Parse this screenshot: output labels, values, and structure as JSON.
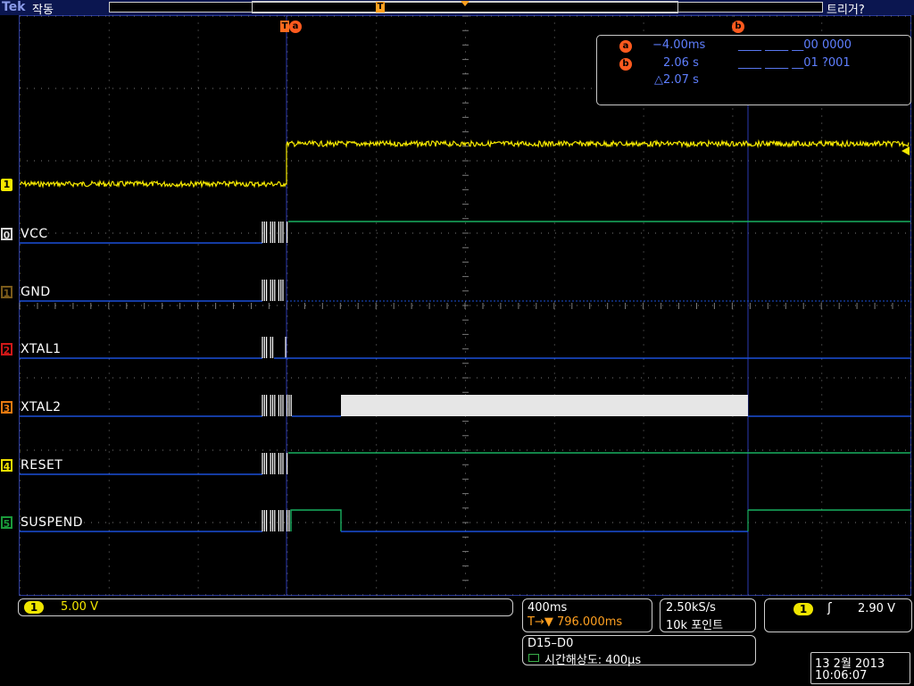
{
  "header": {
    "brand": "Tek",
    "status": "작동",
    "trigger_status": "트리거?",
    "trigger_marker": "T"
  },
  "cursors": {
    "a_label": "a",
    "b_label": "b",
    "a_time": "−4.00ms",
    "a_bits": "____ ____ __00 0000",
    "b_time": "2.06 s",
    "b_bits": "____ ____ __01 ?001",
    "delta": "△2.07 s"
  },
  "analog_channel": {
    "marker": "1",
    "color": "#f5e800"
  },
  "digital_channels": [
    {
      "marker": "0",
      "name": "VCC",
      "marker_color": "#d8d8d8"
    },
    {
      "marker": "1",
      "name": "GND",
      "marker_color": "#7a5a1a"
    },
    {
      "marker": "2",
      "name": "XTAL1",
      "marker_color": "#d01818"
    },
    {
      "marker": "3",
      "name": "XTAL2",
      "marker_color": "#e87a10"
    },
    {
      "marker": "4",
      "name": "RESET",
      "marker_color": "#f0e000"
    },
    {
      "marker": "5",
      "name": "SUSPEND",
      "marker_color": "#1a9a3a"
    }
  ],
  "bottom": {
    "ch1_badge": "1",
    "ch1_scale": "5.00 V",
    "timebase": "400ms",
    "trigger_position": "T→▼ 796.000ms",
    "sample_rate": "2.50kS/s",
    "record_length": "10k 포인트",
    "trig_badge": "1",
    "trig_slope": "ʃ",
    "trig_level": "2.90 V",
    "digital_range": "D15–D0",
    "digital_resolution": "시간해상도: 400μs",
    "date": "13 2월 2013",
    "time": "10:06:07"
  },
  "colors": {
    "grid": "#7a7a7a",
    "low": "#1a4fd8",
    "high": "#19b060",
    "cursor": "#2a38b0"
  }
}
